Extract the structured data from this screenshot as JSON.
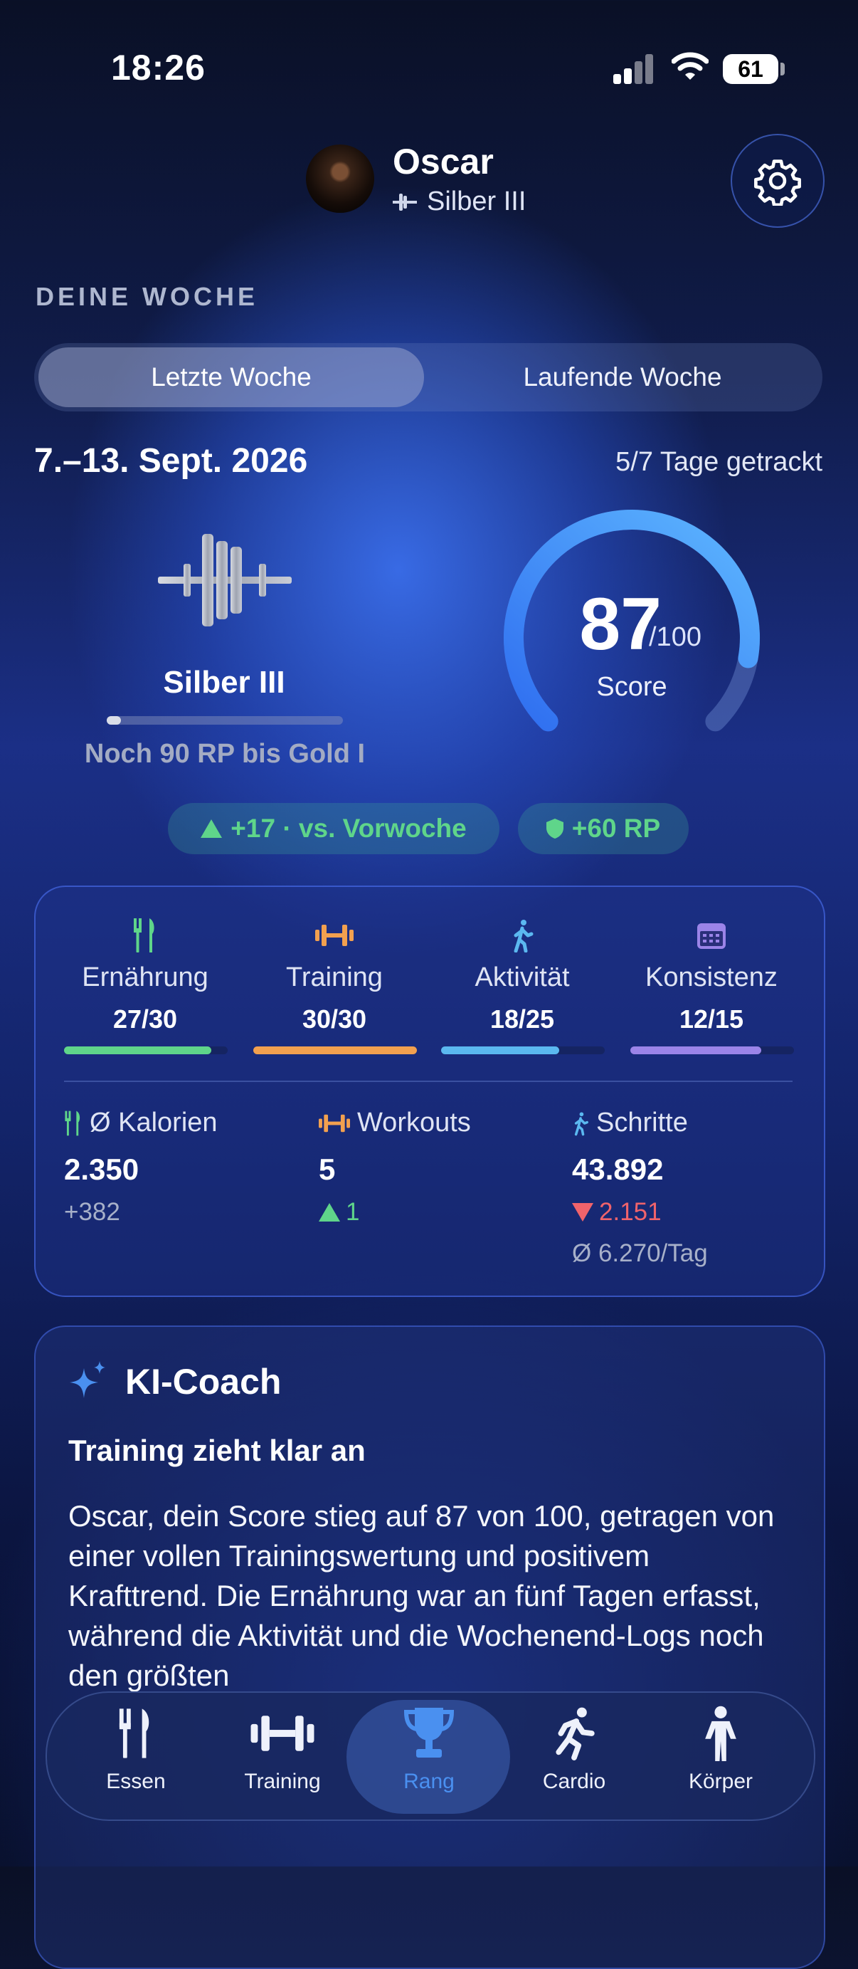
{
  "status_bar": {
    "time": "18:26",
    "battery": "61"
  },
  "profile": {
    "name": "Oscar",
    "rank": "Silber III"
  },
  "section_label": "DEINE WOCHE",
  "segments": {
    "active": "Letzte Woche",
    "inactive": "Laufende Woche"
  },
  "week": {
    "date_range": "7.–13. Sept. 2026",
    "tracked": "5/7 Tage getrackt"
  },
  "rank_card": {
    "name": "Silber III",
    "progress_fraction": 0.06,
    "remaining": "Noch 90 RP bis Gold I"
  },
  "score": {
    "value": "87",
    "max": "/100",
    "label": "Score",
    "fraction": 0.87
  },
  "chips": {
    "vs_last_week": "+17 · vs. Vorwoche",
    "rp": "+60 RP"
  },
  "categories": [
    {
      "label": "Ernährung",
      "score": "27/30",
      "fraction": 0.9,
      "color": "#5fd58a",
      "icon": "fork-knife-icon"
    },
    {
      "label": "Training",
      "score": "30/30",
      "fraction": 1.0,
      "color": "#f2a04f",
      "icon": "dumbbell-icon"
    },
    {
      "label": "Aktivität",
      "score": "18/25",
      "fraction": 0.72,
      "color": "#5bb8f0",
      "icon": "walking-icon"
    },
    {
      "label": "Konsistenz",
      "score": "12/15",
      "fraction": 0.8,
      "color": "#9b84e8",
      "icon": "calendar-icon"
    }
  ],
  "stats": {
    "calories": {
      "label": "Ø Kalorien",
      "value": "2.350",
      "delta": "+382"
    },
    "workouts": {
      "label": "Workouts",
      "value": "5",
      "delta": "1"
    },
    "steps": {
      "label": "Schritte",
      "value": "43.892",
      "delta": "2.151",
      "average": "Ø 6.270/Tag"
    }
  },
  "coach": {
    "title": "KI-Coach",
    "headline": "Training zieht klar an",
    "text": "Oscar, dein Score stieg auf 87 von 100, getragen von einer vollen Trainingswertung und positivem Krafttrend. Die Ernährung war an fünf Tagen erfasst, während die Aktivität und die Wochenend-Logs noch den größten"
  },
  "tabs": [
    {
      "label": "Essen",
      "icon": "fork-knife-icon"
    },
    {
      "label": "Training",
      "icon": "dumbbell-icon"
    },
    {
      "label": "Rang",
      "icon": "trophy-icon",
      "active": true
    },
    {
      "label": "Cardio",
      "icon": "running-icon"
    },
    {
      "label": "Körper",
      "icon": "body-icon"
    }
  ],
  "colors": {
    "accent": "#4a90f0",
    "positive": "#5fd58a",
    "negative": "#f0636b"
  }
}
